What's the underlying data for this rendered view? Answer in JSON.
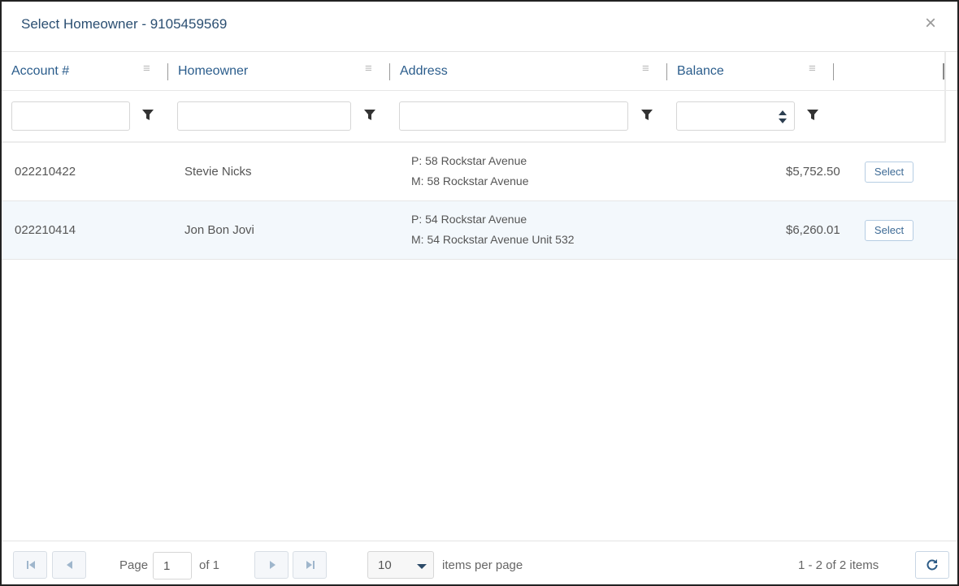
{
  "dialog": {
    "title": "Select Homeowner - 9105459569",
    "close_icon": "×"
  },
  "columns": [
    {
      "label": "Account #"
    },
    {
      "label": "Homeowner"
    },
    {
      "label": "Address"
    },
    {
      "label": "Balance"
    }
  ],
  "filters": {
    "account": "",
    "homeowner": "",
    "address": "",
    "balance": ""
  },
  "rows": [
    {
      "account": "022210422",
      "homeowner": "Stevie Nicks",
      "address_p": "P: 58 Rockstar Avenue",
      "address_m": "M: 58 Rockstar Avenue",
      "balance": "$5,752.50",
      "action": "Select"
    },
    {
      "account": "022210414",
      "homeowner": "Jon Bon Jovi",
      "address_p": "P: 54 Rockstar Avenue",
      "address_m": "M: 54 Rockstar Avenue Unit 532",
      "balance": "$6,260.01",
      "action": "Select"
    }
  ],
  "pager": {
    "page_label": "Page",
    "page_value": "1",
    "of_label": "of 1",
    "page_size": "10",
    "items_per_page": "items per page",
    "summary": "1 - 2 of 2 items"
  },
  "colors": {
    "accent": "#2b5d8c",
    "title": "#2b4f72",
    "row_alt": "#f3f8fc"
  },
  "icons": [
    "close-icon",
    "column-menu-icon",
    "filter-icon",
    "spinner-icon",
    "first-page-icon",
    "prev-page-icon",
    "next-page-icon",
    "last-page-icon",
    "dropdown-caret-icon",
    "refresh-icon"
  ]
}
